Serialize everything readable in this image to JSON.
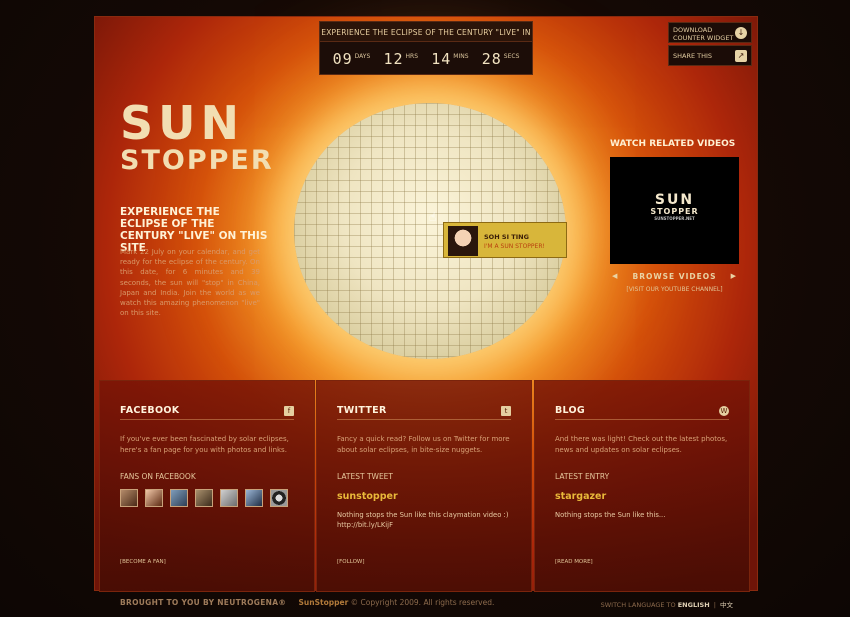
{
  "countdown": {
    "title": "EXPERIENCE THE ECLIPSE OF THE CENTURY \"LIVE\" IN",
    "items": [
      {
        "value": "09",
        "unit": "DAYS"
      },
      {
        "value": "12",
        "unit": "HRS"
      },
      {
        "value": "14",
        "unit": "MINS"
      },
      {
        "value": "28",
        "unit": "SECS"
      }
    ]
  },
  "top_buttons": {
    "download_line1": "DOWNLOAD",
    "download_line2": "COUNTER WIDGET",
    "share": "SHARE THIS"
  },
  "logo": {
    "line1": "SUN",
    "line2": "STOPPER"
  },
  "intro": {
    "title": "EXPERIENCE THE ECLIPSE OF THE CENTURY \"LIVE\" ON THIS SITE",
    "text": "Mark 22 July on your calendar, and get ready for the eclipse of the century. On this date, for 6 minutes and 39 seconds, the sun will \"stop\" in China, Japan and India. Join the world as we watch this amazing phenomenon \"live\" on this site."
  },
  "popup": {
    "name": "SOH SI TING",
    "sub": "I'M A SUN STOPPER!"
  },
  "videos": {
    "title": "WATCH RELATED VIDEOS",
    "logo_line1": "SUN",
    "logo_line2": "STOPPER",
    "logo_line3": "SUNSTOPPER.NET",
    "browse": "BROWSE VIDEOS",
    "yt": "[VISIT OUR YOUTUBE CHANNEL]"
  },
  "facebook": {
    "title": "FACEBOOK",
    "desc": "If you've ever been fascinated by solar eclipses, here's a fan page for you with photos and links.",
    "sub": "FANS ON FACEBOOK",
    "foot": "[BECOME A FAN]"
  },
  "twitter": {
    "title": "TWITTER",
    "desc": "Fancy a quick read? Follow us on Twitter for more about solar eclipses, in bite-size nuggets.",
    "sub": "LATEST TWEET",
    "link": "sunstopper",
    "text": "Nothing stops the Sun like this claymation video :)  http://bit.ly/LKijF",
    "foot": "[FOLLOW]"
  },
  "blog": {
    "title": "BLOG",
    "desc": "And there was light! Check out the latest photos, news and updates on solar eclipses.",
    "sub": "LATEST ENTRY",
    "link": "stargazer",
    "text": "Nothing stops the Sun like this...",
    "foot": "[READ MORE]"
  },
  "footer": {
    "brand": "BROUGHT TO YOU BY NEUTROGENA®",
    "app": "SunStopper",
    "copy": "© Copyright 2009. All rights reserved.",
    "lang_label": "SWITCH LANGUAGE TO",
    "lang_active": "ENGLISH",
    "lang_sep": "|",
    "lang_alt": "中文"
  }
}
